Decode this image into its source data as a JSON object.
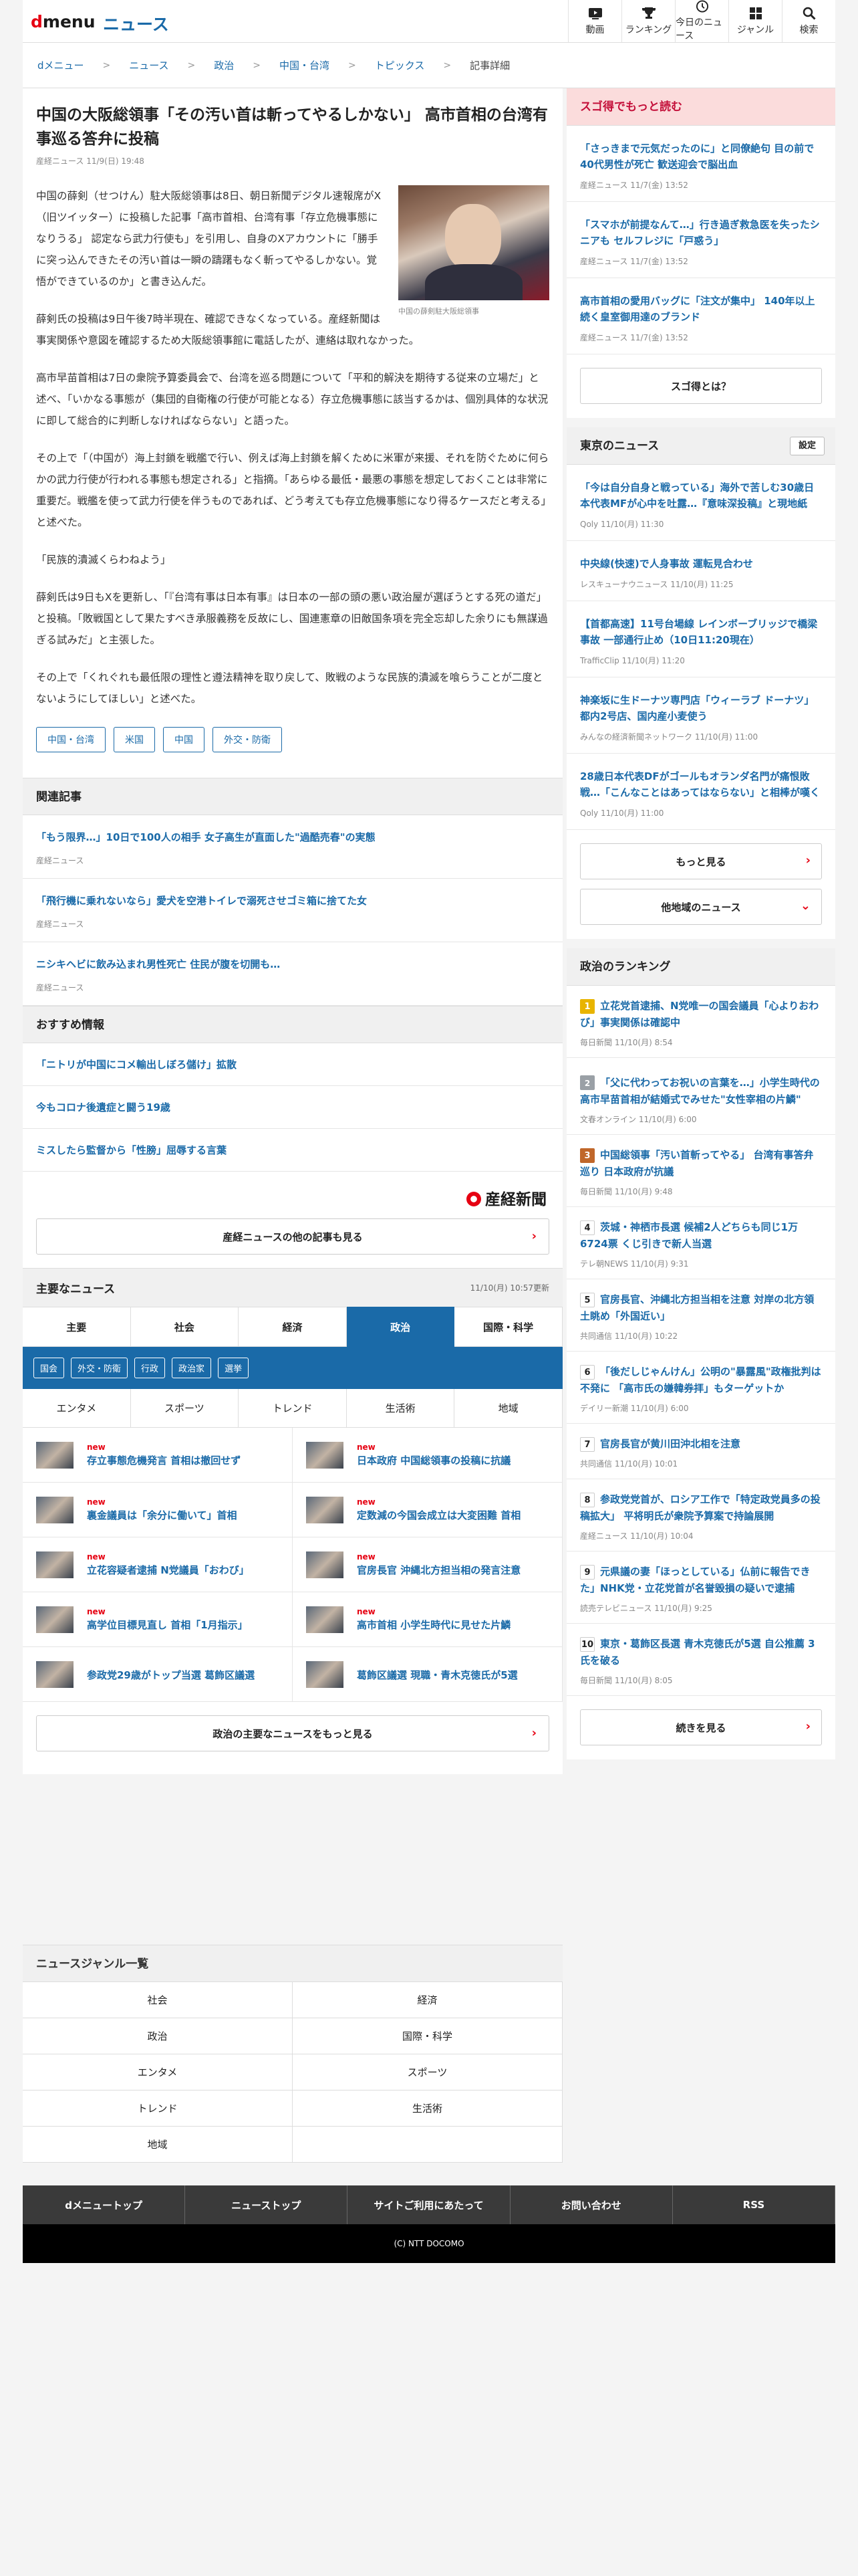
{
  "header": {
    "logo_d": "d",
    "logo_menu": "menu",
    "logo_news": "ニュース",
    "nav": [
      {
        "label": "動画",
        "icon": "video-icon"
      },
      {
        "label": "ランキング",
        "icon": "trophy-icon"
      },
      {
        "label": "今日のニュース",
        "icon": "clock-icon"
      },
      {
        "label": "ジャンル",
        "icon": "grid-icon"
      },
      {
        "label": "検索",
        "icon": "search-icon"
      }
    ]
  },
  "breadcrumb": [
    "dメニュー",
    "ニュース",
    "政治",
    "中国・台湾",
    "トピックス",
    "記事詳細"
  ],
  "article": {
    "title": "中国の大阪総領事「その汚い首は斬ってやるしかない」 高市首相の台湾有事巡る答弁に投稿",
    "meta": "産経ニュース 11/9(日) 19:48",
    "photo_caption": "中国の薛剣駐大阪総領事",
    "paragraphs": [
      "中国の薛剣（せつけん）駐大阪総領事は8日、朝日新聞デジタル速報席がX（旧ツイッター）に投稿した記事「高市首相、台湾有事「存立危機事態になりうる」 認定なら武力行使も」を引用し、自身のXアカウントに「勝手に突っ込んできたその汚い首は一瞬の躊躇もなく斬ってやるしかない。覚悟ができているのか」と書き込んだ。",
      "薛剣氏の投稿は9日午後7時半現在、確認できなくなっている。産経新聞は事実関係や意図を確認するため大阪総領事館に電話したが、連絡は取れなかった。",
      "高市早苗首相は7日の衆院予算委員会で、台湾を巡る問題について「平和的解決を期待する従来の立場だ」と述べ、「いかなる事態が（集団的自衛権の行使が可能となる）存立危機事態に該当するかは、個別具体的な状況に即して総合的に判断しなければならない」と語った。",
      "その上で「（中国が）海上封鎖を戦艦で行い、例えば海上封鎖を解くために米軍が来援、それを防ぐために何らかの武力行使が行われる事態も想定される」と指摘。「あらゆる最低・最悪の事態を想定しておくことは非常に重要だ。戦艦を使って武力行使を伴うものであれば、どう考えても存立危機事態になり得るケースだと考える」と述べた。",
      "「民族的潰滅くらわねよう」",
      "薛剣氏は9日もXを更新し、「『台湾有事は日本有事』は日本の一部の頭の悪い政治屋が選ぼうとする死の道だ」と投稿。「敗戦国として果たすべき承服義務を反故にし、国連憲章の旧敵国条項を完全忘却した余りにも無謀過ぎる試みだ」と主張した。",
      "その上で「くれぐれも最低限の理性と遵法精神を取り戻して、敗戦のような民族的潰滅を喰らうことが二度とないようにしてほしい」と述べた。"
    ],
    "tags": [
      "中国・台湾",
      "米国",
      "中国",
      "外交・防衛"
    ]
  },
  "related": {
    "heading": "関連記事",
    "items": [
      {
        "title": "「もう限界…」10日で100人の相手 女子高生が直面した\"過酷売春\"の実態",
        "source": "産経ニュース"
      },
      {
        "title": "「飛行機に乗れないなら」愛犬を空港トイレで溺死させゴミ箱に捨てた女",
        "source": "産経ニュース"
      },
      {
        "title": "ニシキヘビに飲み込まれ男性死亡 住民が腹を切開も…",
        "source": "産経ニュース"
      }
    ]
  },
  "recommended": {
    "heading": "おすすめ情報",
    "items": [
      "「ニトリが中国にコメ輸出しぼろ儲け」拡散",
      "今もコロナ後遺症と闘う19歳",
      "ミスしたら監督から「性膀」屈辱する言葉"
    ]
  },
  "sankei_logo": "産経新聞",
  "sankei_more": "産経ニュースの他の記事も見る",
  "main_news": {
    "heading": "主要なニュース",
    "updated": "11/10(月) 10:57更新",
    "tabs": [
      "主要",
      "社会",
      "経済",
      "政治",
      "国際・科学"
    ],
    "active_tab": "政治",
    "subtags": [
      "国会",
      "外交・防衛",
      "行政",
      "政治家",
      "選挙"
    ],
    "tabs2": [
      "エンタメ",
      "スポーツ",
      "トレンド",
      "生活術",
      "地域"
    ],
    "new_label": "new",
    "items": [
      {
        "title": "存立事態危機発言 首相は撤回せず",
        "new": true
      },
      {
        "title": "日本政府 中国総領事の投稿に抗議",
        "new": true
      },
      {
        "title": "裏金議員は「余分に働いて」首相",
        "new": true
      },
      {
        "title": "定数減の今国会成立は大変困難 首相",
        "new": true
      },
      {
        "title": "立花容疑者逮捕 N党議員「おわび」",
        "new": true
      },
      {
        "title": "官房長官 沖縄北方担当相の発言注意",
        "new": true
      },
      {
        "title": "高学位目標見直し 首相「1月指示」",
        "new": true
      },
      {
        "title": "高市首相 小学生時代に見せた片鱗",
        "new": true
      },
      {
        "title": "参政党29歳がトップ当選 葛飾区議選",
        "new": false
      },
      {
        "title": "葛飾区議選 現職・青木克徳氏が5選",
        "new": false
      }
    ],
    "more": "政治の主要なニュースをもっと見る"
  },
  "genre": {
    "heading": "ニュースジャンル一覧",
    "items": [
      "社会",
      "経済",
      "政治",
      "国際・科学",
      "エンタメ",
      "スポーツ",
      "トレンド",
      "生活術",
      "地域",
      ""
    ]
  },
  "footer": {
    "nav": [
      "dメニュートップ",
      "ニューストップ",
      "サイトご利用にあたって",
      "お問い合わせ",
      "RSS"
    ],
    "copyright": "(C) NTT DOCOMO"
  },
  "sugotoku": {
    "heading": "スゴ得でもっと読む",
    "items": [
      {
        "title": "「さっきまで元気だったのに」と同僚絶句 目の前で40代男性が死亡 歓送迎会で脳出血",
        "source": "産経ニュース 11/7(金) 13:52"
      },
      {
        "title": "「スマホが前提なんて…」行き過ぎ救急医を失ったシニアも セルフレジに「戸惑う」",
        "source": "産経ニュース 11/7(金) 13:52"
      },
      {
        "title": "高市首相の愛用バッグに「注文が集中」 140年以上続く皇室御用達のブランド",
        "source": "産経ニュース 11/7(金) 13:52"
      }
    ],
    "what": "スゴ得とは？"
  },
  "tokyo": {
    "heading": "東京のニュース",
    "settings": "設定",
    "items": [
      {
        "title": "「今は自分自身と戦っている」海外で苦しむ30歳日本代表MFが心中を吐露…『意味深投稿』と現地紙",
        "source": "Qoly 11/10(月) 11:30"
      },
      {
        "title": "中央線(快速)で人身事故 運転見合わせ",
        "source": "レスキューナウニュース 11/10(月) 11:25"
      },
      {
        "title": "【首都高速】11号台場線 レインボーブリッジで橋梁事故 一部通行止め（10日11:20現在）",
        "source": "TrafficClip 11/10(月) 11:20"
      },
      {
        "title": "神楽坂に生ドーナツ専門店「ウィーラブ ドーナツ」 都内2号店、国内産小麦使う",
        "source": "みんなの経済新聞ネットワーク 11/10(月) 11:00"
      },
      {
        "title": "28歳日本代表DFがゴールもオランダ名門が痛恨敗戦…「こんなことはあってはならない」と相棒が嘆く",
        "source": "Qoly 11/10(月) 11:00"
      }
    ],
    "more": "もっと見る",
    "other": "他地域のニュース"
  },
  "ranking": {
    "heading": "政治のランキング",
    "items": [
      {
        "rank": "1",
        "title": "立花党首逮捕、N党唯一の国会議員「心よりおわび」事実関係は確認中",
        "source": "毎日新聞 11/10(月) 8:54"
      },
      {
        "rank": "2",
        "title": "「父に代わってお祝いの言葉を…」小学生時代の高市早苗首相が結婚式でみせた\"女性宰相の片鱗\"",
        "source": "文春オンライン 11/10(月) 6:00"
      },
      {
        "rank": "3",
        "title": "中国総領事「汚い首斬ってやる」 台湾有事答弁巡り 日本政府が抗議",
        "source": "毎日新聞 11/10(月) 9:48"
      },
      {
        "rank": "4",
        "title": "茨城・神栖市長選 候補2人どちらも同じ1万6724票 くじ引きで新人当選",
        "source": "テレ朝NEWS 11/10(月) 9:31"
      },
      {
        "rank": "5",
        "title": "官房長官、沖縄北方担当相を注意 対岸の北方領土眺め「外国近い」",
        "source": "共同通信 11/10(月) 10:22"
      },
      {
        "rank": "6",
        "title": "「後だしじゃんけん」公明の\"暴露風\"政権批判は不発に 「高市氏の嫌韓券拝」もターゲットか",
        "source": "デイリー新潮 11/10(月) 6:00"
      },
      {
        "rank": "7",
        "title": "官房長官が黄川田沖北相を注意",
        "source": "共同通信 11/10(月) 10:01"
      },
      {
        "rank": "8",
        "title": "参政党党首が、ロシア工作で「特定政党員多の投稿拡大」 平将明氏が衆院予算案で持論展開",
        "source": "産経ニュース 11/10(月) 10:04"
      },
      {
        "rank": "9",
        "title": "元県議の妻「ほっとしている」仏前に報告できた」NHK党・立花党首が名誉毀損の疑いで逮捕",
        "source": "読売テレビニュース 11/10(月) 9:25"
      },
      {
        "rank": "10",
        "title": "東京・葛飾区長選 青木克徳氏が5選 自公推薦 3氏を破る",
        "source": "毎日新聞 11/10(月) 8:05"
      }
    ],
    "more": "続きを見る"
  }
}
